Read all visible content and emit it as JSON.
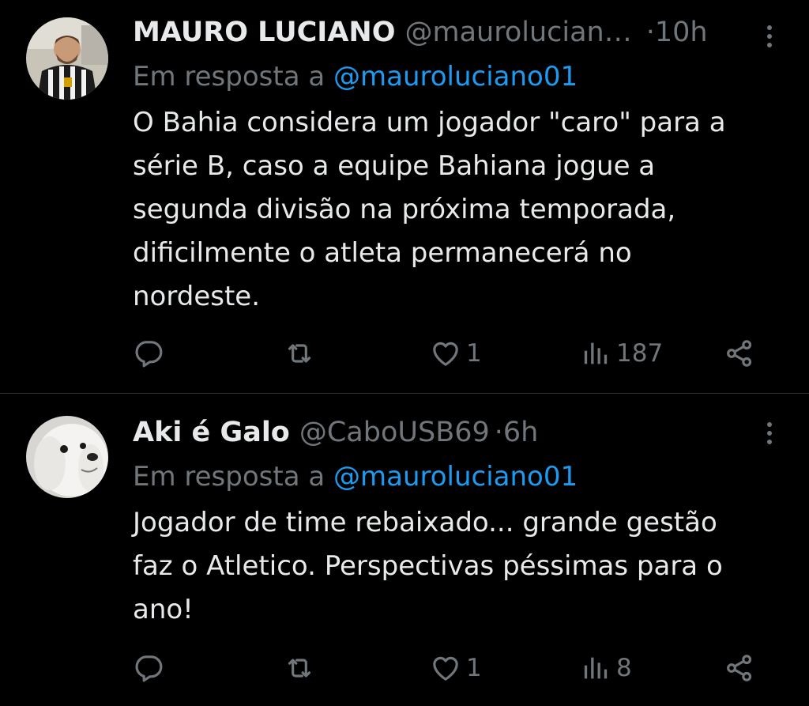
{
  "tweets": [
    {
      "name": "MAURO LUCIANO",
      "handle": "@maurolucian…",
      "dot": "·",
      "time": "10h",
      "reply_prefix": "Em resposta a",
      "reply_mention": "@mauroluciano01",
      "text_lines": [
        "O Bahia considera um jogador \"caro\" para a",
        "série B, caso a equipe Bahiana jogue a",
        "segunda divisão na próxima temporada,",
        "dificilmente o atleta permanecerá no",
        "nordeste."
      ],
      "likes": "1",
      "views": "187"
    },
    {
      "name": "Aki é Galo",
      "handle": "@CaboUSB69",
      "dot": "·",
      "time": "6h",
      "reply_prefix": "Em resposta a",
      "reply_mention": "@mauroluciano01",
      "text_lines": [
        "Jogador de time rebaixado... grande gestão",
        "faz o Atletico. Perspectivas péssimas para o",
        "ano!"
      ],
      "likes": "1",
      "views": "8"
    }
  ],
  "colors": {
    "background": "#000000",
    "text_primary": "#e7e9ea",
    "text_secondary": "#71767b",
    "link": "#1d9bf0",
    "divider": "#2f3336"
  },
  "icons": [
    "reply-icon",
    "retweet-icon",
    "like-icon",
    "views-icon",
    "share-icon",
    "more-options-icon"
  ]
}
